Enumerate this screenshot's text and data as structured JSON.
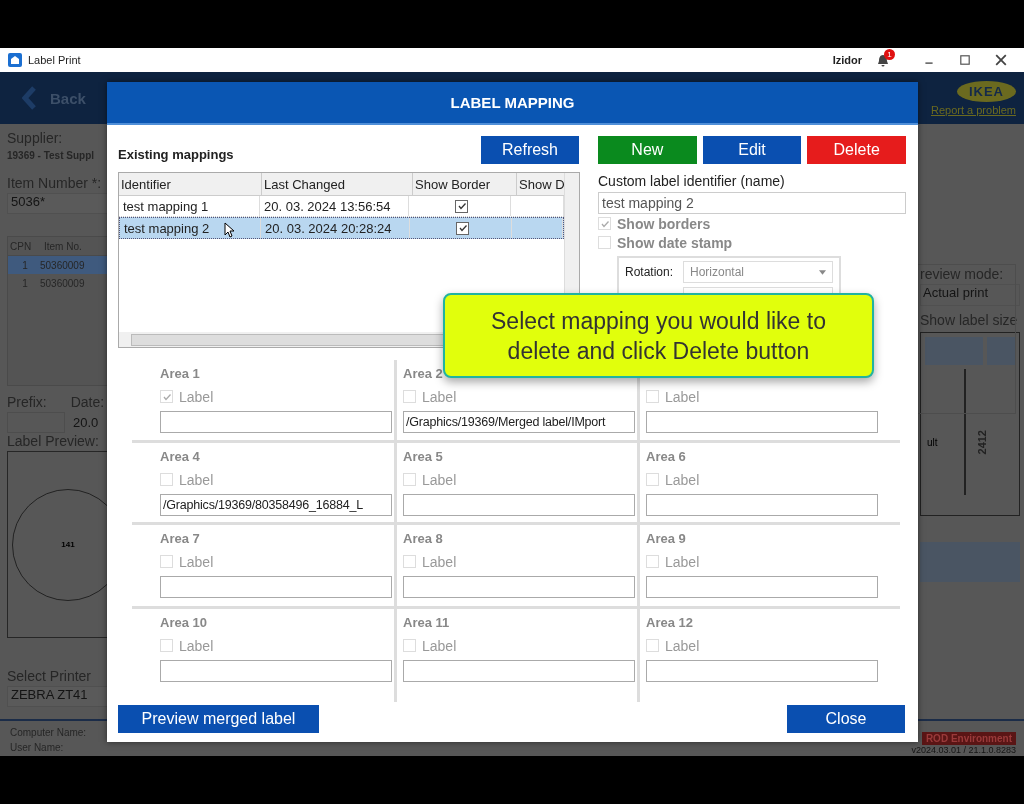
{
  "window": {
    "title": "Label Print",
    "user": "Izidor",
    "notification_count": "1"
  },
  "header": {
    "back": "Back",
    "logo": "IKEA",
    "report_link": "Report a problem"
  },
  "left_panel": {
    "supplier_label": "Supplier:",
    "supplier_value": "19369 - Test Suppl",
    "item_number_label": "Item Number *:",
    "item_number_value": "5036*",
    "columns": [
      "CPN",
      "Item No."
    ],
    "rows": [
      {
        "cpn": "1",
        "item": "50360009",
        "selected": true
      },
      {
        "cpn": "1",
        "item": "50360009",
        "selected": false
      }
    ],
    "prefix_label": "Prefix:",
    "date_label": "Date:",
    "date_value": "20.0",
    "label_preview_label": "Label Preview:",
    "preview_text": "141",
    "select_printer_label": "Select Printer",
    "printer_value": "ZEBRA ZT41"
  },
  "right_panel": {
    "preview_mode_label": "review mode:",
    "preview_mode_value": "Actual print",
    "show_label_size": "Show label size",
    "preview_number": "2412",
    "preview_text": "ult"
  },
  "footer": {
    "computer_name_label": "Computer Name:",
    "user_name_label": "User Name:",
    "environment": "ROD Environment",
    "version": "v2024.03.01 / 21.1.0.8283"
  },
  "dialog": {
    "title": "LABEL MAPPING",
    "existing_mappings_title": "Existing mappings",
    "refresh": "Refresh",
    "table": {
      "columns": [
        "Identifier",
        "Last Changed",
        "Show Border",
        "Show D"
      ],
      "rows": [
        {
          "identifier": "test mapping 1",
          "last_changed": "20. 03. 2024 13:56:54",
          "show_border": true,
          "selected": false
        },
        {
          "identifier": "test mapping 2",
          "last_changed": "20. 03. 2024 20:28:24",
          "show_border": true,
          "selected": true
        }
      ]
    },
    "actions": [
      {
        "label": "New",
        "color": "#0a8a1e"
      },
      {
        "label": "Edit",
        "color": "#0a4fb0"
      },
      {
        "label": "Delete",
        "color": "#e61c1c"
      }
    ],
    "identifier_label": "Custom label identifier (name)",
    "identifier_value": "test mapping 2",
    "options": [
      {
        "label": "Show borders",
        "checked": true
      },
      {
        "label": "Show date stamp",
        "checked": false
      }
    ],
    "rotation_label": "Rotation:",
    "rotation_value": "Horizontal",
    "areas": [
      {
        "title": "Area 1",
        "label": "Label",
        "checked": true
      },
      {
        "title": "Area 2",
        "label": "Label",
        "checked": false,
        "value": "/Graphics/19369/Merged label/IMport"
      },
      {
        "label": "Label",
        "checked": false
      },
      {
        "title": "Area 4",
        "label": "Label",
        "checked": false,
        "value": "/Graphics/19369/80358496_16884_L"
      },
      {
        "title": "Area 5",
        "label": "Label",
        "checked": false
      },
      {
        "title": "Area 6",
        "label": "Label",
        "checked": false
      },
      {
        "title": "Area 7",
        "label": "Label",
        "checked": false
      },
      {
        "title": "Area 8",
        "label": "Label",
        "checked": false
      },
      {
        "title": "Area 9",
        "label": "Label",
        "checked": false
      },
      {
        "title": "Area 10",
        "label": "Label",
        "checked": false
      },
      {
        "title": "Area 11",
        "label": "Label",
        "checked": false
      },
      {
        "title": "Area 12",
        "label": "Label",
        "checked": false
      }
    ],
    "preview_button": "Preview merged label",
    "close_button": "Close"
  },
  "tooltip": {
    "text": "Select mapping you would like to delete and click Delete button"
  }
}
